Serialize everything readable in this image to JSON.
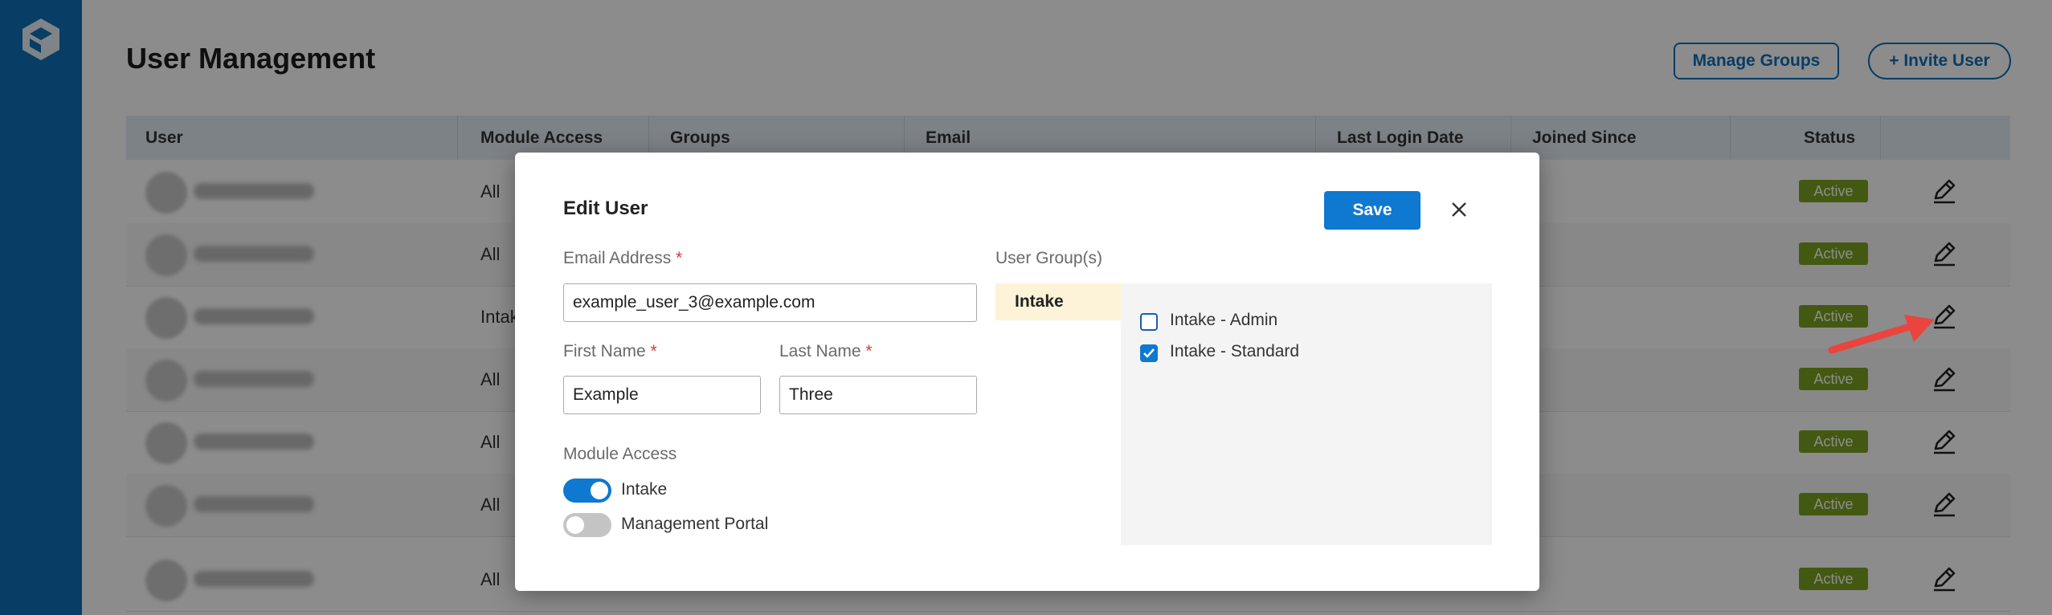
{
  "page": {
    "title": "User Management",
    "manage_groups_label": "Manage Groups",
    "invite_user_label": "+ Invite User"
  },
  "table": {
    "columns": [
      "User",
      "Module Access",
      "Groups",
      "Email",
      "Last Login Date",
      "Joined Since",
      "Status"
    ],
    "rows": [
      {
        "module_access": "All",
        "status": "Active"
      },
      {
        "module_access": "All",
        "status": "Active"
      },
      {
        "module_access": "Intak",
        "status": "Active"
      },
      {
        "module_access": "All",
        "status": "Active"
      },
      {
        "module_access": "All",
        "status": "Active"
      },
      {
        "module_access": "All",
        "status": "Active"
      },
      {
        "module_access": "All",
        "status": "Active"
      }
    ]
  },
  "modal": {
    "title": "Edit User",
    "save_label": "Save",
    "email_label": "Email Address",
    "email_value": "example_user_3@example.com",
    "first_name_label": "First Name",
    "first_name_value": "Example",
    "last_name_label": "Last Name",
    "last_name_value": "Three",
    "required_marker": "*",
    "module_access_label": "Module Access",
    "modules": [
      {
        "label": "Intake",
        "enabled": true
      },
      {
        "label": "Management Portal",
        "enabled": false
      }
    ],
    "user_groups_label": "User Group(s)",
    "group_tab": "Intake",
    "groups": [
      {
        "label": "Intake - Admin",
        "checked": false
      },
      {
        "label": "Intake - Standard",
        "checked": true
      }
    ]
  },
  "icons": {
    "logo": "logo-icon",
    "edit": "pencil-icon",
    "close": "close-icon",
    "arrow": "annotation-arrow-icon"
  },
  "colors": {
    "sidebar": "#0f6fb8",
    "primary": "#0f78d0",
    "status_active": "#7aa31f",
    "required": "#d9383a",
    "arrow": "#e9453e"
  }
}
